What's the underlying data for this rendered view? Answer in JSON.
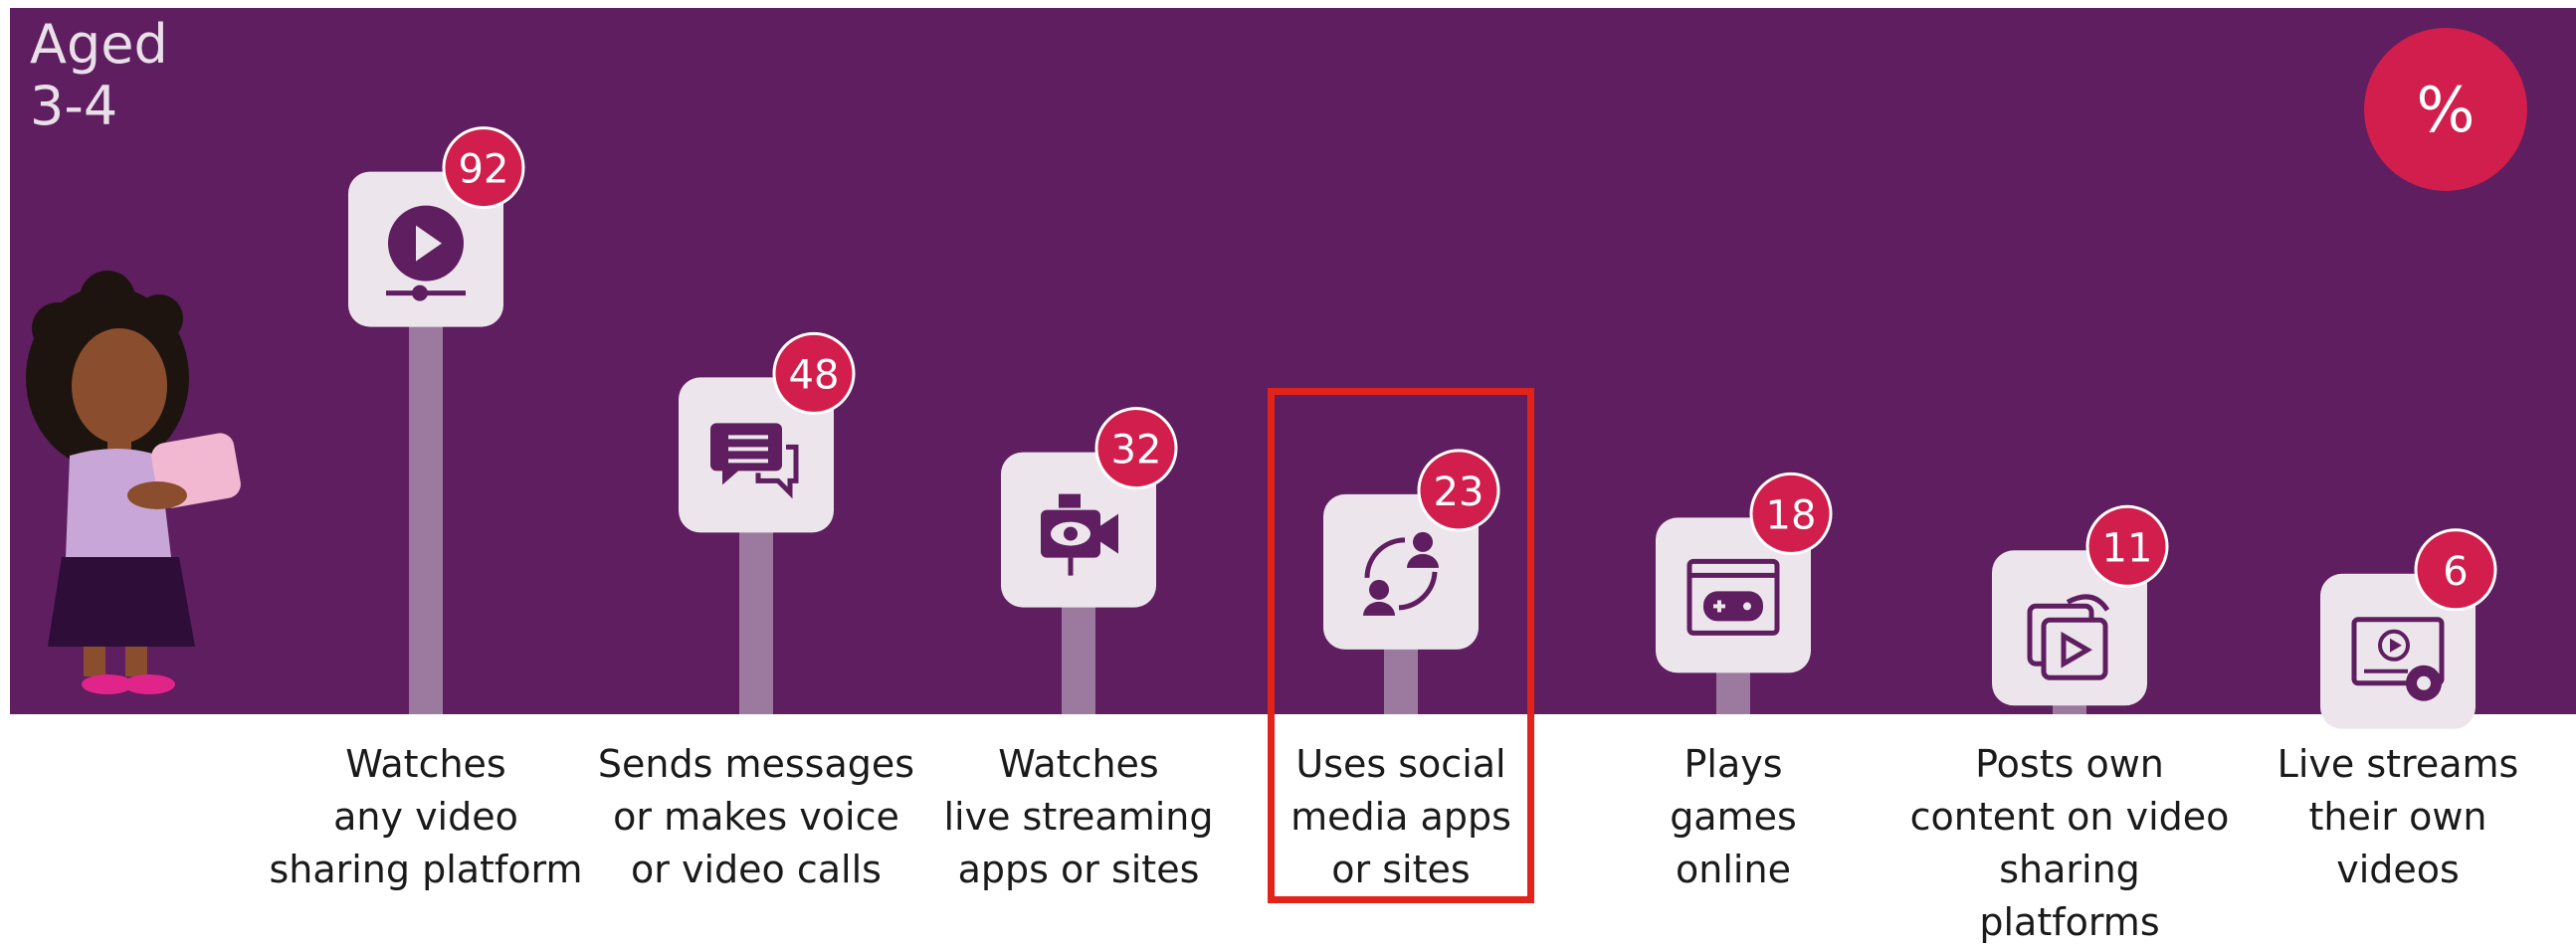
{
  "panel": {
    "title_lines": [
      "Aged",
      "3-4"
    ],
    "unit": "%"
  },
  "colors": {
    "background": "#5e1e5f",
    "stem": "#9c7aa0",
    "tile": "#ece6ec",
    "badge": "#d21e4c",
    "icon": "#5e1e5f",
    "highlight": "#e2231a"
  },
  "chart_data": {
    "type": "bar",
    "title": "",
    "unit": "%",
    "categories": [
      "Watches any video sharing platform",
      "Sends messages or makes voice or video calls",
      "Watches live streaming apps or sites",
      "Uses social media apps or sites",
      "Plays games online",
      "Posts own content on video sharing platforms",
      "Live streams their own videos"
    ],
    "label_lines": [
      [
        "Watches",
        "any video",
        "sharing platform"
      ],
      [
        "Sends messages",
        "or makes voice",
        "or video calls"
      ],
      [
        "Watches",
        "live streaming",
        "apps or sites"
      ],
      [
        "Uses social",
        "media apps",
        "or sites"
      ],
      [
        "Plays",
        "games",
        "online"
      ],
      [
        "Posts own",
        "content on video",
        "sharing platforms"
      ],
      [
        "Live streams",
        "their own",
        "videos"
      ]
    ],
    "icons": [
      "video-play-icon",
      "chat-bubbles-icon",
      "video-camera-eye-icon",
      "social-network-icon",
      "game-controller-icon",
      "video-upload-icon",
      "live-stream-icon"
    ],
    "values": [
      92,
      48,
      32,
      23,
      18,
      11,
      6
    ],
    "highlighted_category": "Uses social media apps or sites",
    "ylim": [
      0,
      100
    ]
  }
}
